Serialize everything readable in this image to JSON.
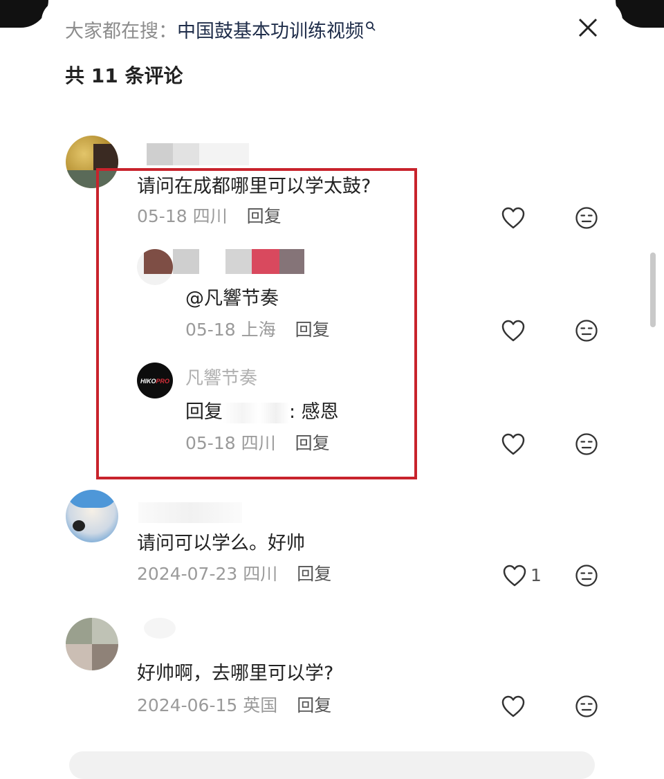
{
  "search": {
    "prefix": "大家都在搜：",
    "keyword": "中国鼓基本功训练视频"
  },
  "header": {
    "comment_count": "共 11 条评论"
  },
  "comments": [
    {
      "text": "请问在成都哪里可以学太鼓?",
      "date": "05-18",
      "location": "四川",
      "reply_label": "回复",
      "replies": [
        {
          "text": "@凡響节奏",
          "date": "05-18",
          "location": "上海",
          "reply_label": "回复"
        },
        {
          "username": "凡響节奏",
          "avatar_text": "HIKOPRO",
          "reply_prefix": "回复",
          "reply_body": ": 感恩",
          "date": "05-18",
          "location": "四川",
          "reply_label": "回复"
        }
      ]
    },
    {
      "text": "请问可以学么。好帅",
      "date": "2024-07-23",
      "location": "四川",
      "reply_label": "回复",
      "likes": "1"
    },
    {
      "text": "好帅啊，去哪里可以学?",
      "date": "2024-06-15",
      "location": "英国",
      "reply_label": "回复"
    }
  ],
  "colors": {
    "highlight": "#c8232c",
    "icon": "#333333"
  },
  "icons": {
    "close": "close-icon",
    "like": "heart-outline-icon",
    "dislike": "meh-face-icon",
    "search": "search-icon"
  }
}
